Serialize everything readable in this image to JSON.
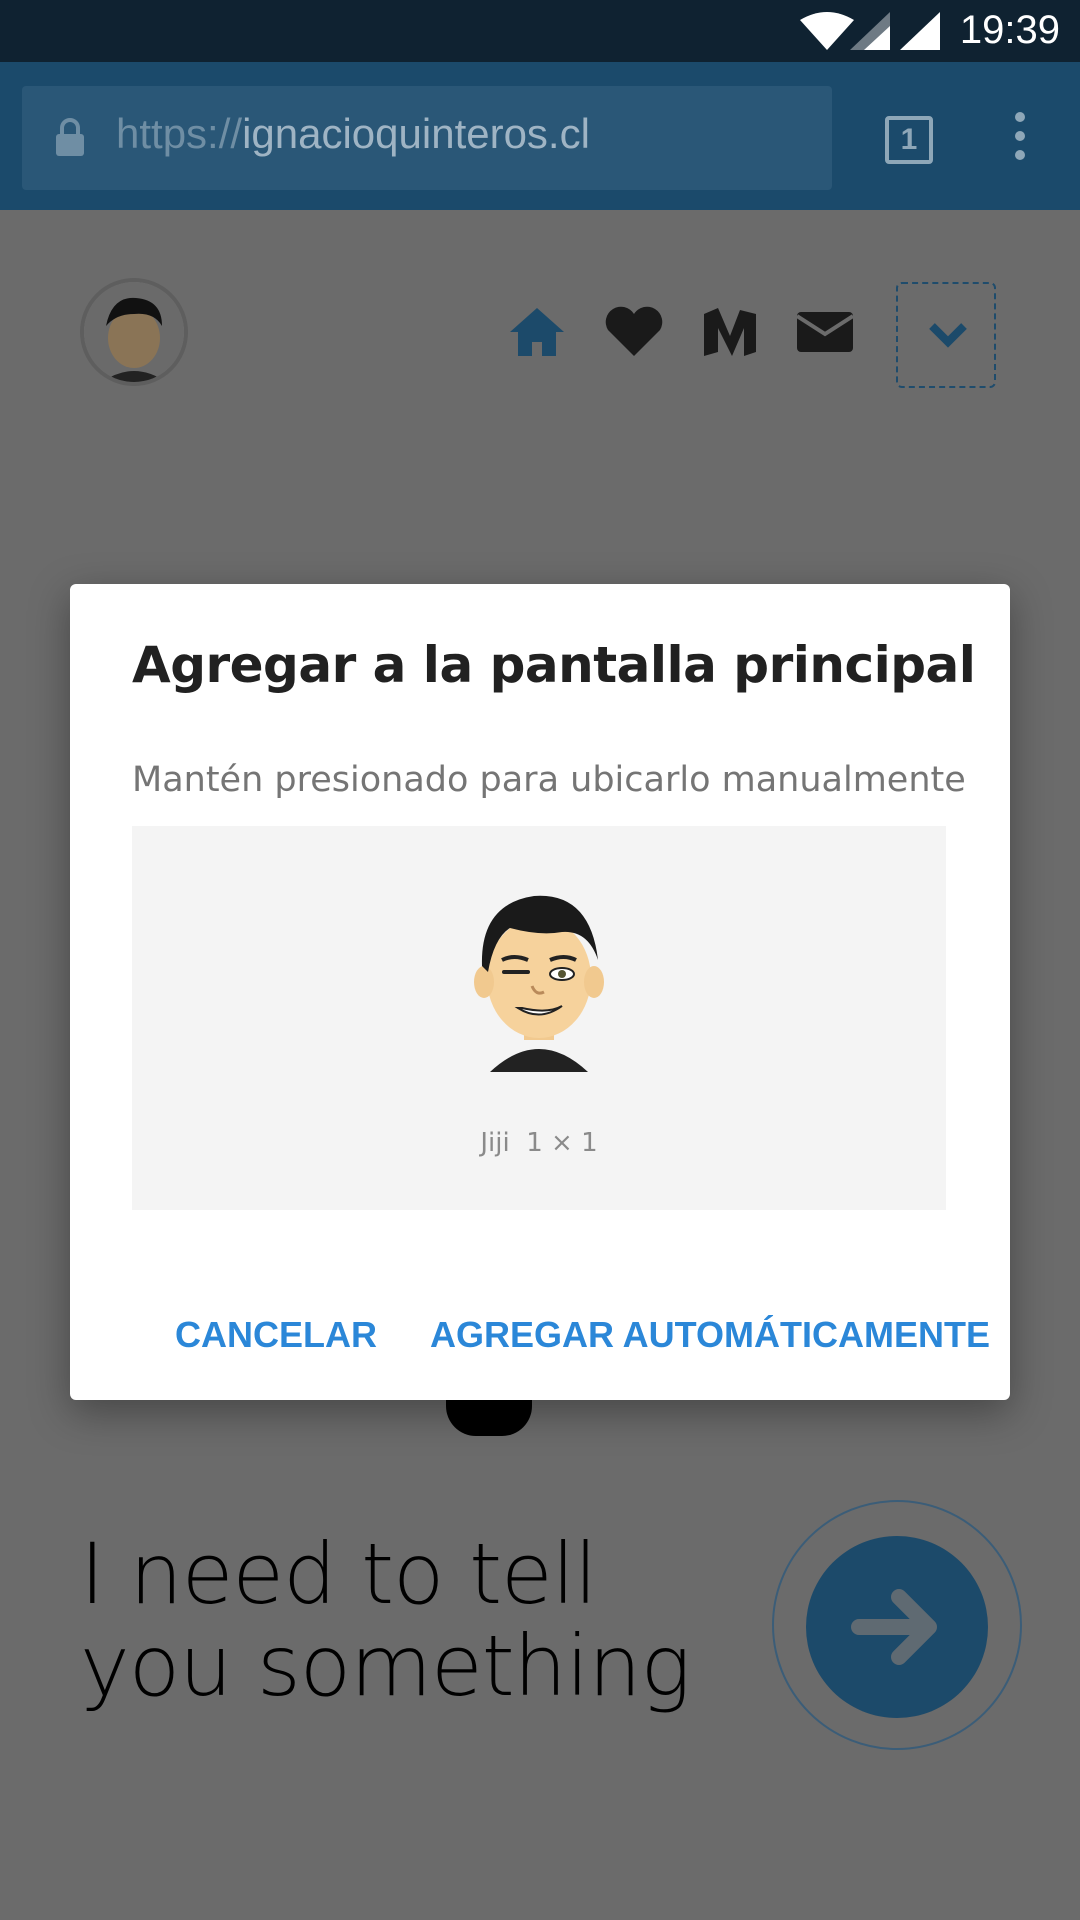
{
  "status_bar": {
    "time": "19:39"
  },
  "browser": {
    "url_scheme": "https://",
    "url_host": "ignacioquinteros.cl",
    "tab_count": "1"
  },
  "site": {
    "nav_icons": [
      "home-icon",
      "heart-icon",
      "medium-icon",
      "envelope-icon"
    ],
    "headline": "I need to tell you something"
  },
  "dialog": {
    "title": "Agregar a la pantalla principal",
    "hint": "Mantén presionado para ubicarlo manualmente",
    "app_label": "Jiji",
    "app_size": "1 × 1",
    "cancel_label": "CANCELAR",
    "add_label": "AGREGAR AUTOMÁTICAMENTE"
  },
  "colors": {
    "accent": "#2b87d8",
    "toolbar": "#1b4a6b",
    "status_bar": "#0f2231"
  }
}
